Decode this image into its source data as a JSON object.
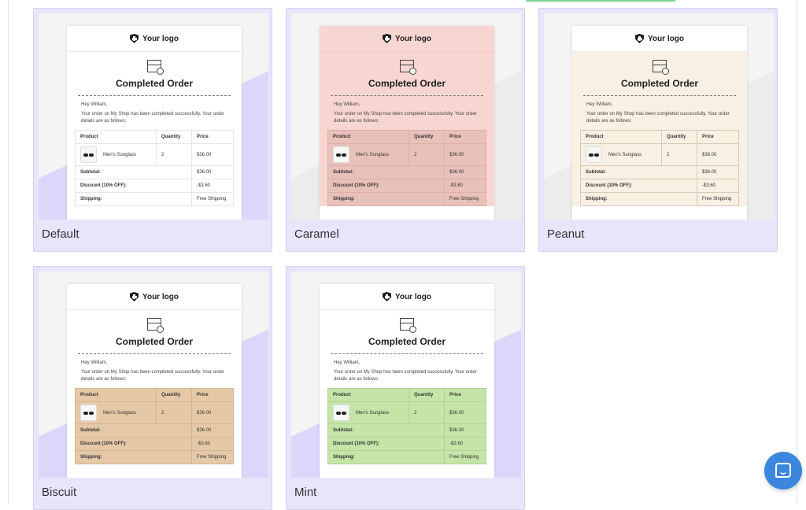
{
  "email": {
    "logo": "Your logo",
    "title": "Completed Order",
    "greeting": "Hey William,",
    "message": "Your order on My Shop has been completed successfully. Your order details are as follows:",
    "columns": {
      "product": "Product",
      "quantity": "Quantity",
      "price": "Price"
    },
    "item": {
      "name": "Men's Sunglass",
      "quantity": "2",
      "price": "$36.00"
    },
    "subtotal_label": "Subtotal:",
    "subtotal_value": "$36.00",
    "discount_label": "Discount (10% OFF):",
    "discount_value": "-$3.60",
    "shipping_label": "Shipping:",
    "shipping_value": "Free Shipping"
  },
  "templates": [
    {
      "name": "Default",
      "accent": "#ddd6fb"
    },
    {
      "name": "Caramel",
      "accent": "#ececec"
    },
    {
      "name": "Peanut",
      "accent": "#ececec"
    },
    {
      "name": "Biscuit",
      "accent": "#ddd6fb"
    },
    {
      "name": "Mint",
      "accent": "#ddd6fb"
    }
  ],
  "chat": {
    "icon": "chat-icon"
  }
}
